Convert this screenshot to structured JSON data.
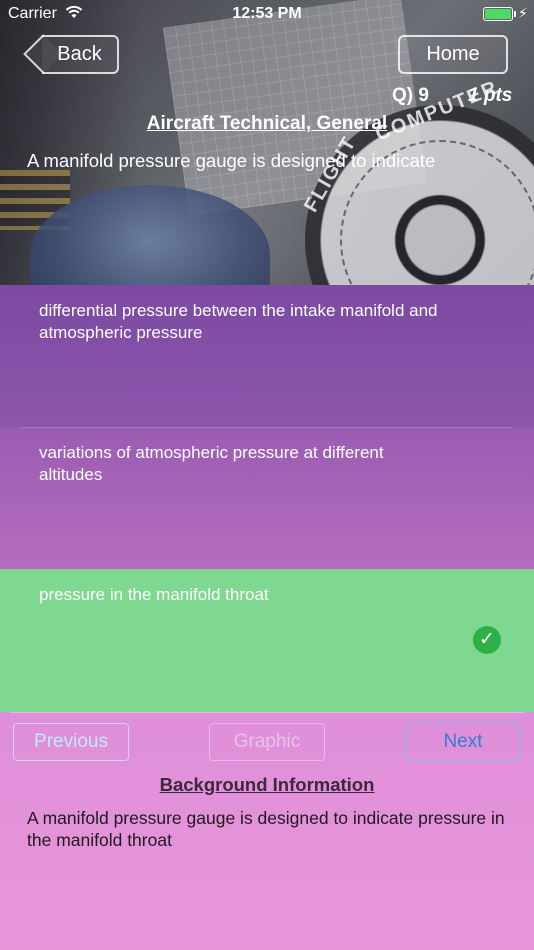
{
  "status_bar": {
    "carrier": "Carrier",
    "time": "12:53 PM",
    "battery_level": 1.0,
    "battery_color": "#4cd964"
  },
  "header": {
    "back_label": "Back",
    "home_label": "Home",
    "question_number": "Q) 9",
    "points": "1 pts",
    "category": "Aircraft Technical, General",
    "question": "A manifold pressure gauge is designed to indicate",
    "photo_text": [
      "FLIGHT",
      "COMPUTER"
    ]
  },
  "answers": [
    {
      "text": "differential pressure between the intake manifold and atmospheric pressure",
      "correct": false
    },
    {
      "text": "variations of atmospheric pressure at different altitudes",
      "correct": false
    },
    {
      "text": "pressure in the manifold throat",
      "correct": true,
      "icon": "check-icon"
    }
  ],
  "footer": {
    "previous_label": "Previous",
    "graphic_label": "Graphic",
    "next_label": "Next",
    "background_title": "Background Information",
    "background_text": "A manifold pressure gauge is designed to indicate pressure in the manifold throat"
  },
  "colors": {
    "correct_answer": "#7ed88f",
    "check_badge": "#2fb046",
    "answer_purple": "#7b4aa2",
    "panel_pink": "#df8ed9",
    "next_button": "#2f7fcf"
  }
}
